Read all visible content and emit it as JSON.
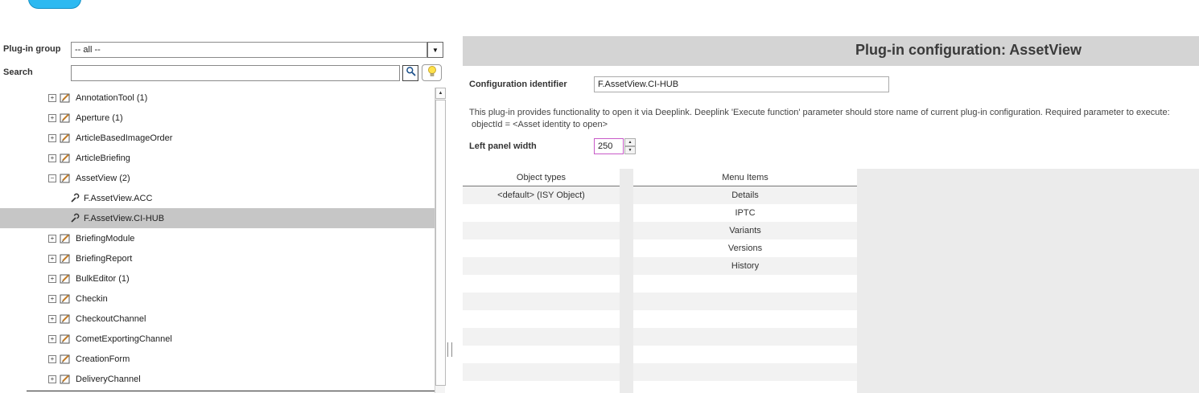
{
  "icons": {
    "expand_collapsed": "+",
    "expand_expanded": "−",
    "dropdown_arrow": "▼",
    "spinner_up": "▲",
    "spinner_down": "▼",
    "scroll_up": "▲"
  },
  "left_panel": {
    "plugin_group": {
      "label": "Plug-in group",
      "value": "-- all --"
    },
    "search": {
      "label": "Search",
      "value": ""
    },
    "tree": [
      {
        "label": "AnnotationTool (1)"
      },
      {
        "label": "Aperture (1)"
      },
      {
        "label": "ArticleBasedImageOrder"
      },
      {
        "label": "ArticleBriefing"
      },
      {
        "label": "AssetView (2)"
      },
      {
        "label": "F.AssetView.ACC"
      },
      {
        "label": "F.AssetView.CI-HUB"
      },
      {
        "label": "BriefingModule"
      },
      {
        "label": "BriefingReport"
      },
      {
        "label": "BulkEditor (1)"
      },
      {
        "label": "Checkin"
      },
      {
        "label": "CheckoutChannel"
      },
      {
        "label": "CometExportingChannel"
      },
      {
        "label": "CreationForm"
      },
      {
        "label": "DeliveryChannel"
      }
    ]
  },
  "main": {
    "title": "Plug-in configuration: AssetView",
    "config_identifier": {
      "label": "Configuration identifier",
      "value": "F.AssetView.CI-HUB"
    },
    "description_line1": "This plug-in provides functionality to open it via Deeplink. Deeplink 'Execute function' parameter should store name of current plug-in configuration. Required parameter to execute:",
    "description_line2": "objectId = <Asset identity to open>",
    "left_panel_width": {
      "label": "Left panel width",
      "value": "250"
    },
    "object_types": {
      "header": "Object types",
      "rows": [
        "<default> (ISY Object)"
      ]
    },
    "menu_items": {
      "header": "Menu Items",
      "rows": [
        "Details",
        "IPTC",
        "Variants",
        "Versions",
        "History"
      ]
    }
  }
}
